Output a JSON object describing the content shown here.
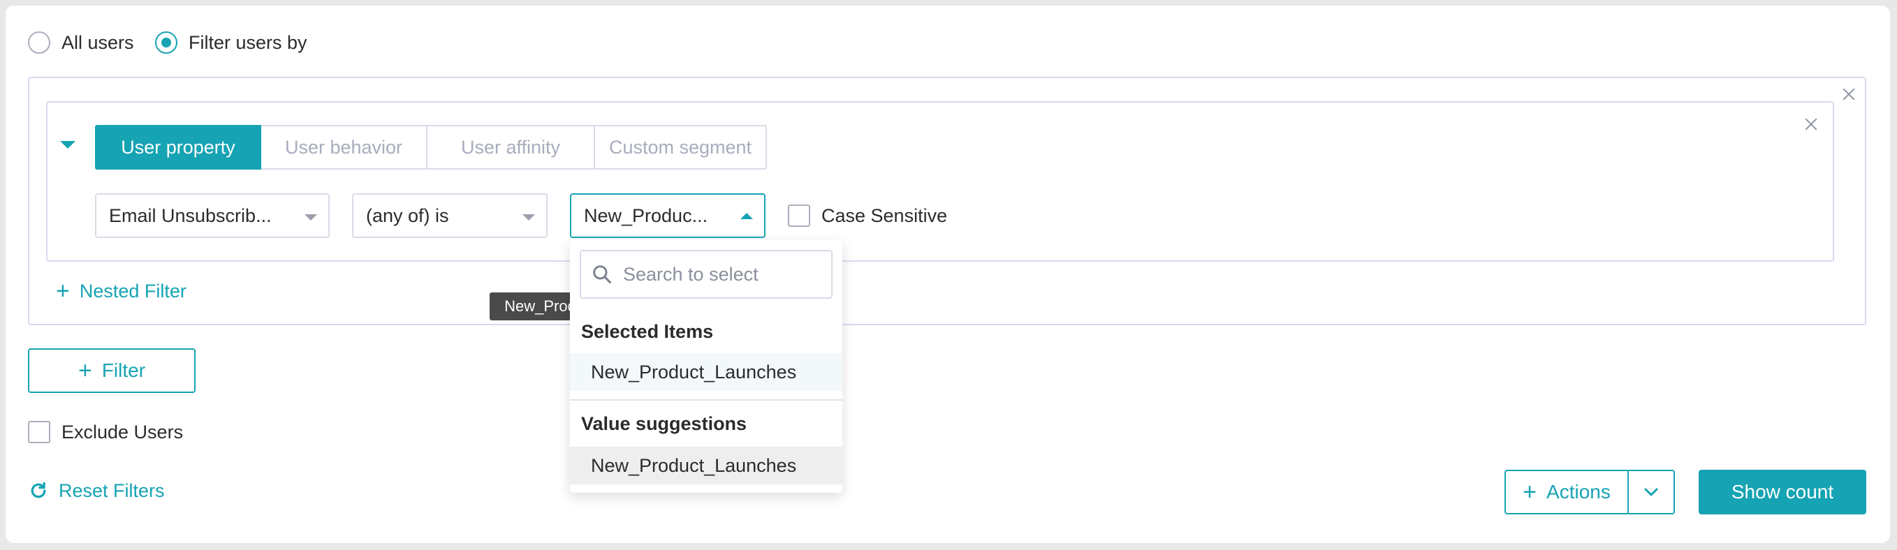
{
  "colors": {
    "accent": "#16a3b3",
    "border": "#d8dce6",
    "tooltip_bg": "#4a4a4a"
  },
  "scope": {
    "all_users_label": "All users",
    "filter_users_label": "Filter users by",
    "selected": "Filter users by"
  },
  "filter": {
    "tabs": [
      {
        "label": "User property",
        "active": true
      },
      {
        "label": "User behavior",
        "active": false
      },
      {
        "label": "User affinity",
        "active": false
      },
      {
        "label": "Custom segment",
        "active": false
      }
    ],
    "property_select": "Email Unsubscrib...",
    "operator_select": "(any of) is",
    "value_select": "New_Produc...",
    "case_sensitive_label": "Case Sensitive",
    "case_sensitive_checked": false
  },
  "nested_filter_label": "Nested Filter",
  "tooltip": "New_Product_Launches",
  "dropdown": {
    "search_placeholder": "Search to select",
    "selected_heading": "Selected Items",
    "selected_items": [
      "New_Product_Launches"
    ],
    "suggestions_heading": "Value suggestions",
    "suggestions": [
      "New_Product_Launches"
    ]
  },
  "add_filter_label": "Filter",
  "exclude_users_label": "Exclude Users",
  "reset_filters_label": "Reset Filters",
  "actions_label": "Actions",
  "show_count_label": "Show count",
  "icons": {
    "plus": "plus-icon",
    "refresh": "refresh-icon",
    "search": "search-icon",
    "close": "close-icon",
    "chevron": "chevron-down-icon"
  }
}
